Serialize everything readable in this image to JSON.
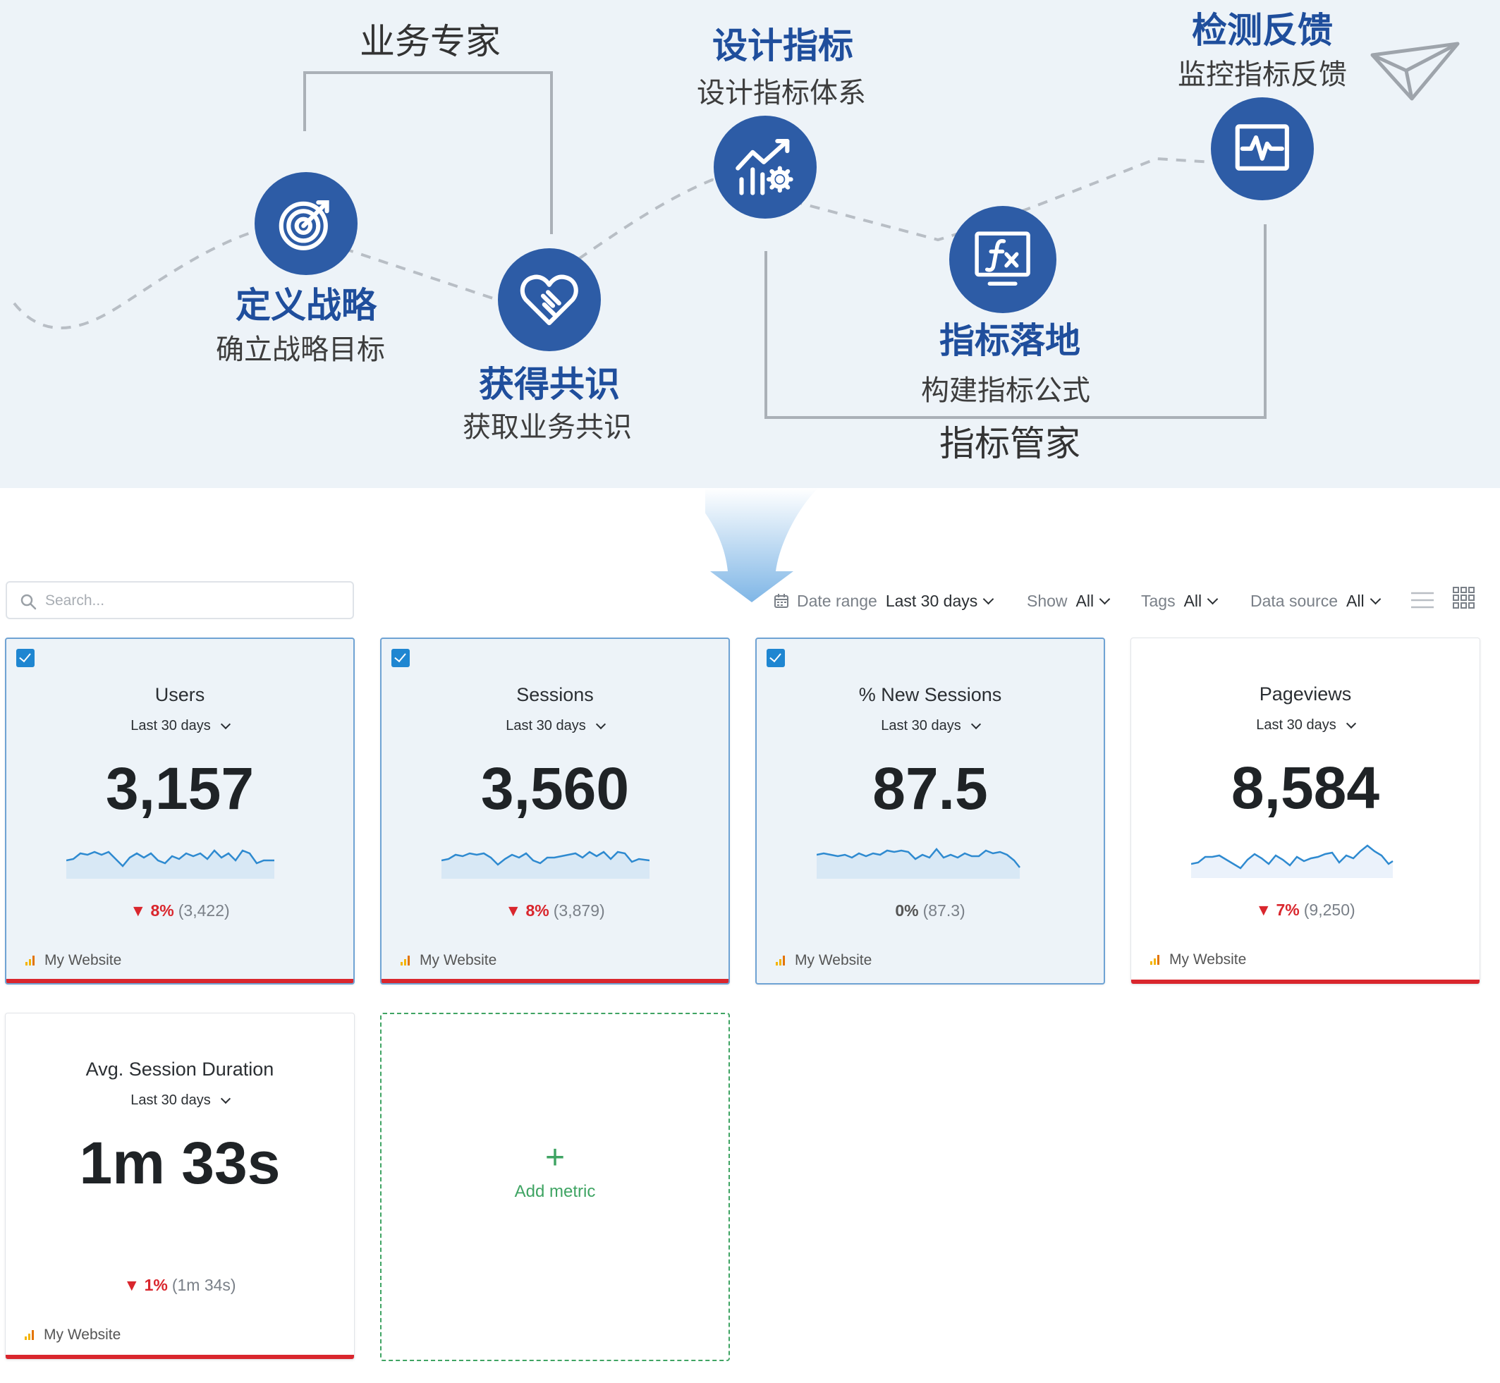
{
  "flow": {
    "roles": {
      "business_expert": "业务专家",
      "metric_steward": "指标管家"
    },
    "steps": [
      {
        "title": "定义战略",
        "subtitle": "确立战略目标",
        "icon": "target-icon"
      },
      {
        "title": "获得共识",
        "subtitle": "获取业务共识",
        "icon": "heart-handshake-icon"
      },
      {
        "title": "设计指标",
        "subtitle": "设计指标体系",
        "icon": "chart-gear-icon"
      },
      {
        "title": "指标落地",
        "subtitle": "构建指标公式",
        "icon": "formula-monitor-icon"
      },
      {
        "title": "检测反馈",
        "subtitle": "监控指标反馈",
        "icon": "pulse-monitor-icon"
      }
    ],
    "colors": {
      "node": "#2d5ca6",
      "title": "#1f4e9c",
      "background": "#edf3f8",
      "arrow": "#8ec0ea"
    }
  },
  "toolbar": {
    "search": {
      "placeholder": "Search..."
    },
    "filters": [
      {
        "label": "Date range",
        "value": "Last 30 days"
      },
      {
        "label": "Show",
        "value": "All"
      },
      {
        "label": "Tags",
        "value": "All"
      },
      {
        "label": "Data source",
        "value": "All"
      }
    ],
    "views": [
      "list-view-icon",
      "grid-view-icon"
    ]
  },
  "metrics": [
    {
      "title": "Users",
      "period": "Last 30 days",
      "value": "3,157",
      "change": "8%",
      "direction": "down",
      "previous": "(3,422)",
      "source": "My Website",
      "selected": true
    },
    {
      "title": "Sessions",
      "period": "Last 30 days",
      "value": "3,560",
      "change": "8%",
      "direction": "down",
      "previous": "(3,879)",
      "source": "My Website",
      "selected": true
    },
    {
      "title": "% New Sessions",
      "period": "Last 30 days",
      "value": "87.5",
      "change": "0%",
      "direction": "flat",
      "previous": "(87.3)",
      "source": "My Website",
      "selected": true
    },
    {
      "title": "Pageviews",
      "period": "Last 30 days",
      "value": "8,584",
      "change": "7%",
      "direction": "down",
      "previous": "(9,250)",
      "source": "My Website",
      "selected": false
    },
    {
      "title": "Avg. Session Duration",
      "period": "Last 30 days",
      "value": "1m 33s",
      "change": "1%",
      "direction": "down",
      "previous": "(1m 34s)",
      "source": "My Website",
      "selected": false
    }
  ],
  "add_metric": {
    "plus": "+",
    "label": "Add metric"
  },
  "colors": {
    "accent": "#1f86d1",
    "negative": "#d9262d",
    "add": "#3fa463",
    "selected_bg": "#edf3f8"
  }
}
